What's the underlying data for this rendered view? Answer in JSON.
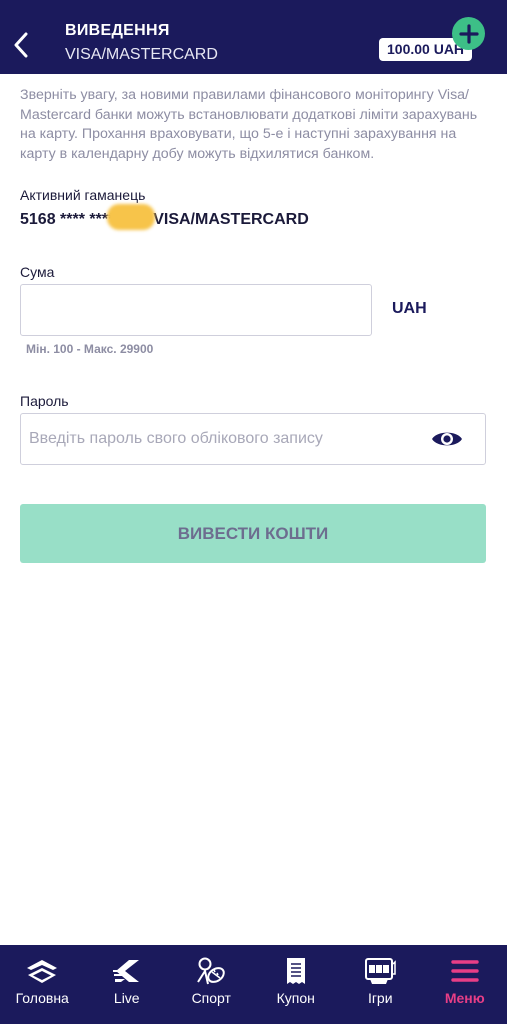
{
  "header": {
    "title": "ВИВЕДЕННЯ",
    "subtitle": "VISA/MASTERCARD",
    "balance": "100.00 UAH"
  },
  "notice": "Зверніть увагу, за новими правилами фінансового моніторингу Visa/ Mastercard банки можуть встановлювати додаткові ліміти зарахувань на карту. Прохання враховувати, що 5-е і наступні зарахування на карту в календарну добу можуть відхилятися банком.",
  "wallet": {
    "label": "Активний гаманець",
    "prefix": "5168 **** ****",
    "suffix": "VISA/MASTERCARD"
  },
  "amount": {
    "label": "Сума",
    "value": "",
    "currency": "UAH",
    "limits": "Мін. 100 - Макс. 29900"
  },
  "password": {
    "label": "Пароль",
    "placeholder": "Введіть пароль свого облікового запису"
  },
  "submit_label": "ВИВЕСТИ КОШТИ",
  "nav": {
    "items": [
      {
        "label": "Головна",
        "icon": "home-icon"
      },
      {
        "label": "Live",
        "icon": "live-icon"
      },
      {
        "label": "Спорт",
        "icon": "sport-icon"
      },
      {
        "label": "Купон",
        "icon": "coupon-icon"
      },
      {
        "label": "Ігри",
        "icon": "games-icon"
      },
      {
        "label": "Меню",
        "icon": "menu-icon",
        "active": true
      }
    ]
  },
  "colors": {
    "header_bg": "#1b1a5c",
    "accent_green": "#3dbf87",
    "button_bg": "#98dfc7",
    "active_nav": "#e83e86"
  }
}
